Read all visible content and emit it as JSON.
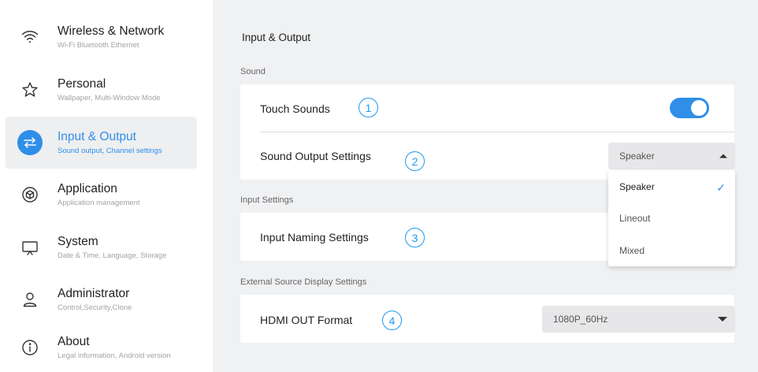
{
  "sidebar": {
    "items": [
      {
        "title": "Wireless & Network",
        "subtitle": "Wi-Fi Bluetooth Ethernet",
        "icon": "wifi-icon",
        "active": false
      },
      {
        "title": "Personal",
        "subtitle": "Wallpaper, Multi-Window Mode",
        "icon": "star-icon",
        "active": false
      },
      {
        "title": "Input & Output",
        "subtitle": "Sound output, Channel settings",
        "icon": "swap-arrows-icon",
        "active": true
      },
      {
        "title": "Application",
        "subtitle": "Application management",
        "icon": "cube-icon",
        "active": false
      },
      {
        "title": "System",
        "subtitle": "Date & Time, Language, Storage",
        "icon": "monitor-icon",
        "active": false
      },
      {
        "title": "Administrator",
        "subtitle": "Control,Security,Clone",
        "icon": "user-icon",
        "active": false
      },
      {
        "title": "About",
        "subtitle": "Legal information, Android version",
        "icon": "info-icon",
        "active": false
      }
    ]
  },
  "main": {
    "title": "Input & Output",
    "sections": {
      "sound": {
        "label": "Sound",
        "touch_sounds": {
          "label": "Touch Sounds",
          "badge": "1",
          "enabled": true
        },
        "sound_output": {
          "label": "Sound Output Settings",
          "badge": "2",
          "value": "Speaker"
        }
      },
      "input": {
        "label": "Input Settings",
        "input_naming": {
          "label": "Input Naming Settings",
          "badge": "3"
        }
      },
      "external": {
        "label": "External Source Display Settings",
        "hdmi_out": {
          "label": "HDMI OUT Format",
          "badge": "4",
          "value": "1080P_60Hz"
        }
      }
    },
    "dropdown": {
      "options": [
        "Speaker",
        "Lineout",
        "Mixed"
      ],
      "selected": "Speaker",
      "check": "✓"
    }
  },
  "colors": {
    "accent": "#2f8ee8",
    "badge": "#1e9af0",
    "background": "#f0f1f3",
    "active_item_bg": "#eeeff1"
  }
}
